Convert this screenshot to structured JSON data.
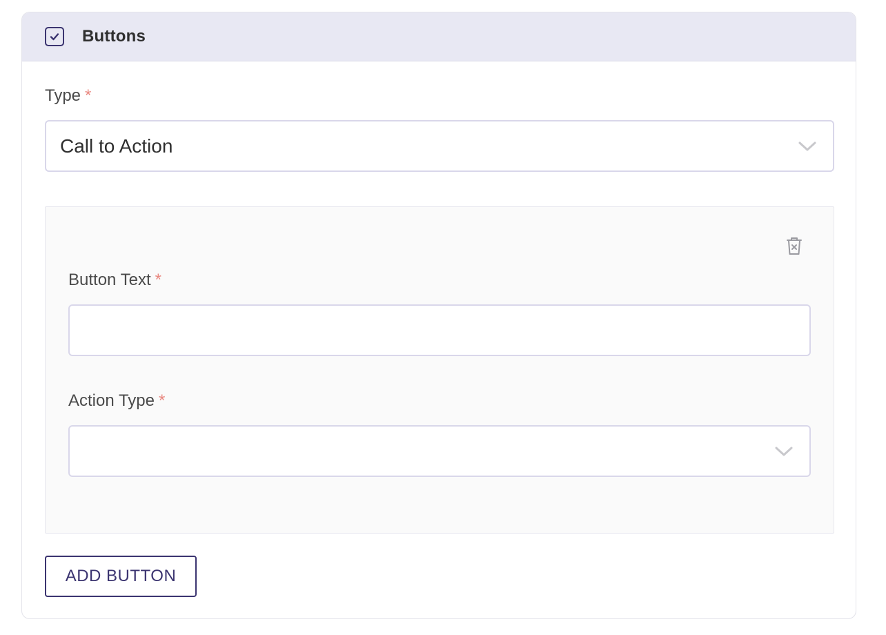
{
  "section": {
    "title": "Buttons",
    "checked": true
  },
  "type_field": {
    "label": "Type",
    "required_mark": "*",
    "value": "Call to Action"
  },
  "button_item": {
    "text_field": {
      "label": "Button Text",
      "required_mark": "*",
      "value": ""
    },
    "action_type_field": {
      "label": "Action Type",
      "required_mark": "*",
      "value": ""
    }
  },
  "actions": {
    "add_button_label": "ADD BUTTON"
  },
  "icons": {
    "checkbox": "check-icon",
    "dropdown": "chevron-down-icon",
    "delete": "trash-icon"
  },
  "colors": {
    "accent": "#3b3470",
    "header_bg": "#e8e8f3",
    "required": "#e98880",
    "border": "#d9d7ea"
  }
}
